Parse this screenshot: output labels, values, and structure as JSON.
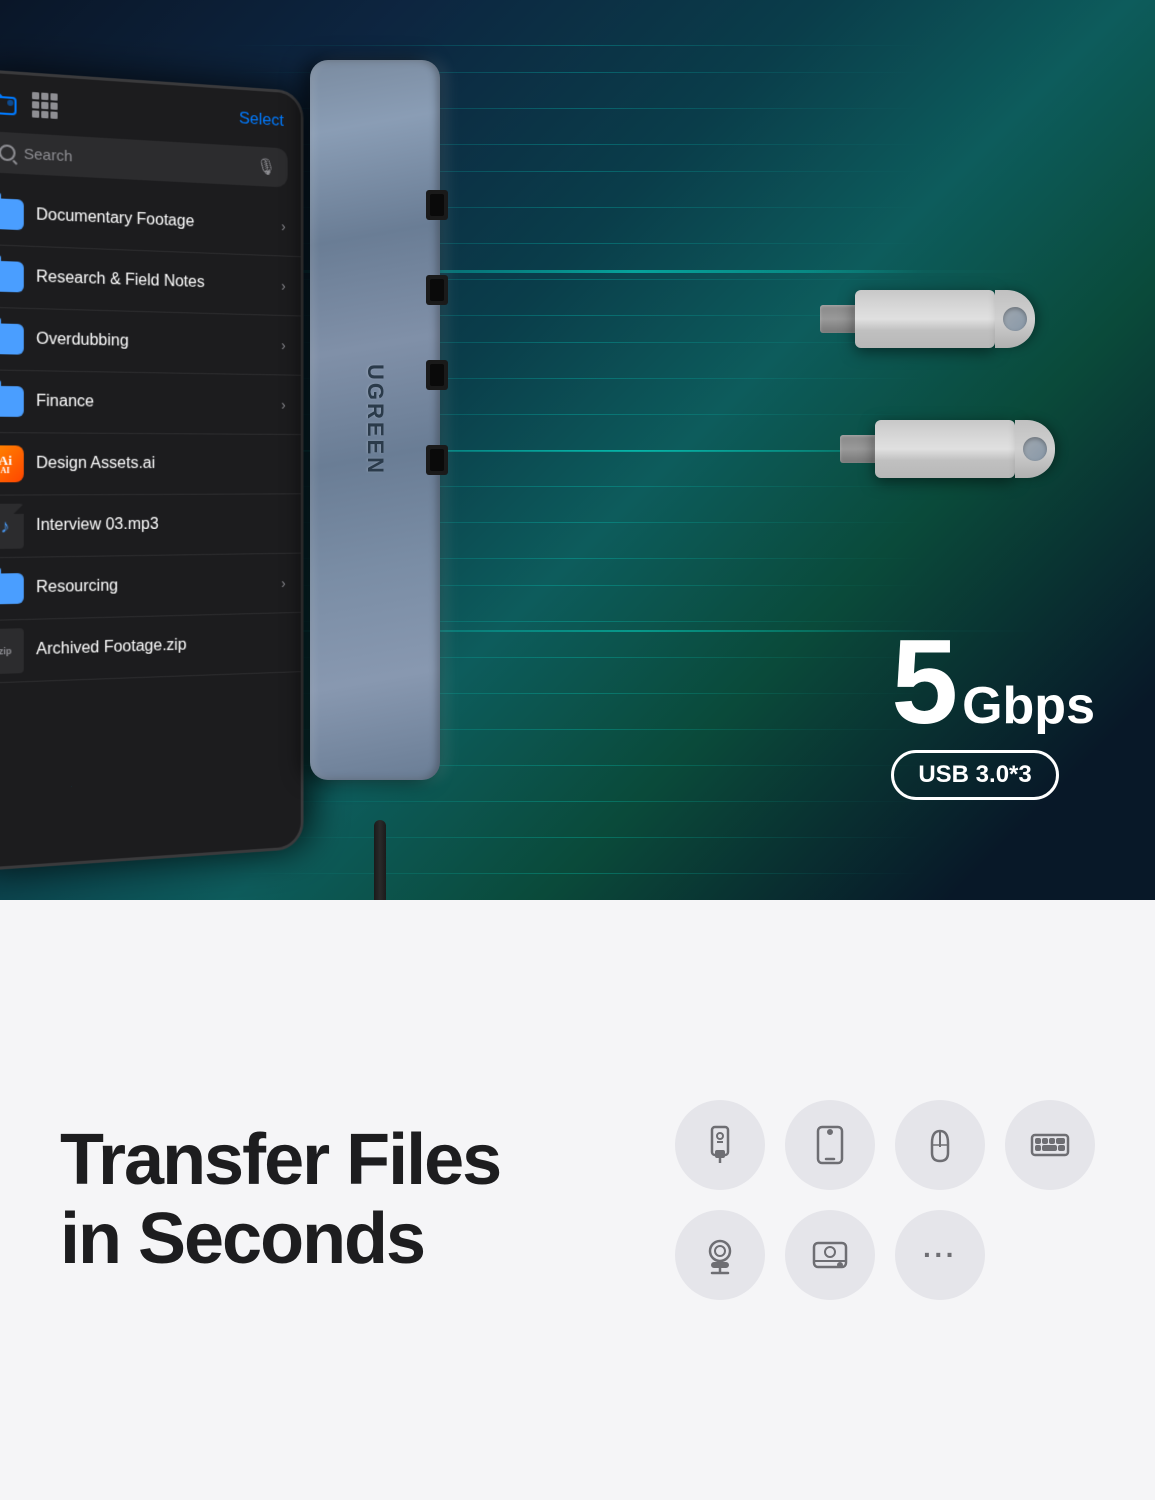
{
  "top": {
    "tablet": {
      "topbar": {
        "select_label": "Select"
      },
      "search": {
        "placeholder": "Search"
      },
      "files": [
        {
          "name": "Documentary Footage",
          "type": "folder",
          "color": "blue",
          "hasChevron": true
        },
        {
          "name": "Research & Field Notes",
          "type": "folder",
          "color": "blue",
          "hasChevron": true
        },
        {
          "name": "Overdubbing",
          "type": "folder",
          "color": "blue",
          "hasChevron": true
        },
        {
          "name": "Finance",
          "type": "folder",
          "color": "blue",
          "hasChevron": true
        },
        {
          "name": "Design Assets.ai",
          "type": "ai",
          "hasChevron": false
        },
        {
          "name": "Interview 03.mp3",
          "type": "mp3",
          "hasChevron": false
        },
        {
          "name": "Resourcing",
          "type": "folder",
          "color": "blue",
          "hasChevron": true
        },
        {
          "name": "Archived Footage.zip",
          "type": "zip",
          "hasChevron": false
        }
      ]
    },
    "speed": {
      "number": "5",
      "unit": "Gbps",
      "badge": "USB 3.0*3"
    },
    "hub_brand": "UGREEN"
  },
  "bottom": {
    "headline_line1": "Transfer Files",
    "headline_line2": "in Seconds",
    "icons": [
      {
        "name": "usb-drive-icon",
        "symbol": "💾"
      },
      {
        "name": "phone-icon",
        "symbol": "📱"
      },
      {
        "name": "mouse-icon",
        "symbol": "🖱️"
      },
      {
        "name": "keyboard-icon",
        "symbol": "⌨️"
      },
      {
        "name": "camera-icon",
        "symbol": "📷"
      },
      {
        "name": "drive-icon",
        "symbol": "💿"
      },
      {
        "name": "more-icon",
        "symbol": "···"
      }
    ]
  }
}
